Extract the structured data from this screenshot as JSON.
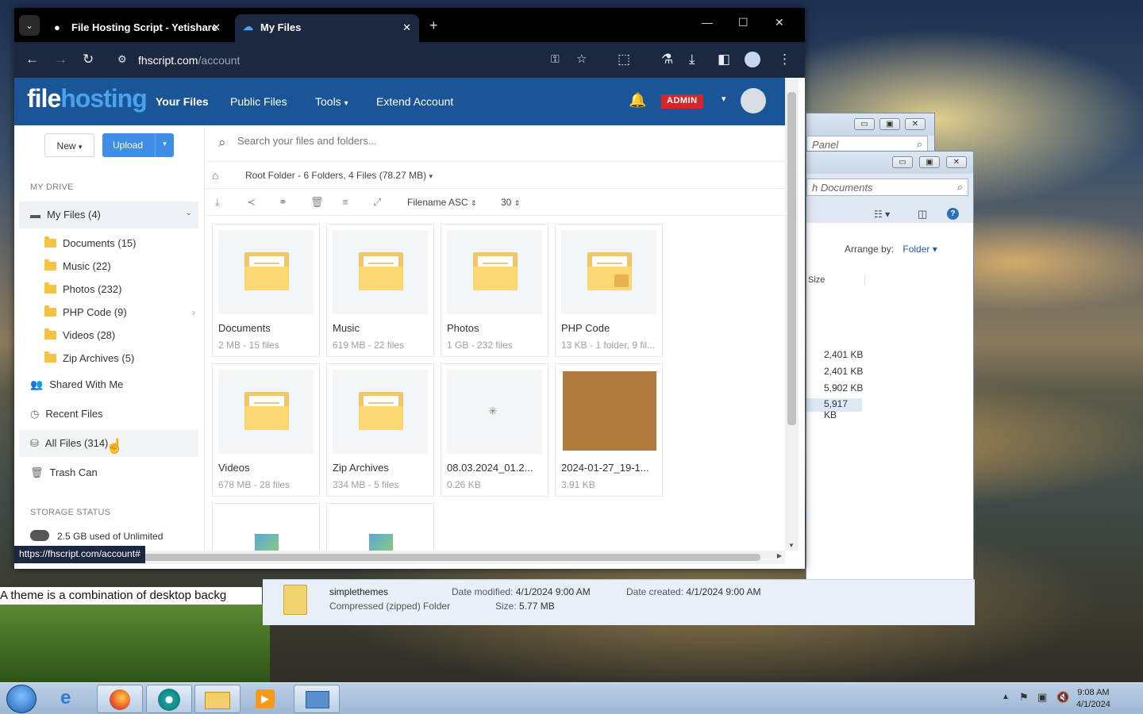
{
  "browser": {
    "tabs": [
      {
        "title": "File Hosting Script - Yetishare"
      },
      {
        "title": "My Files"
      }
    ],
    "url_domain": "fhscript.com",
    "url_path": "/account",
    "status_url": "https://fhscript.com/account#"
  },
  "app": {
    "logo_a": "file",
    "logo_b": "hosting",
    "nav": [
      "Your Files",
      "Public Files",
      "Tools",
      "Extend Account"
    ],
    "admin_badge": "ADMIN",
    "new_label": "New",
    "upload_label": "Upload",
    "search_placeholder": "Search your files and folders...",
    "breadcrumb": "Root Folder - 6 Folders, 4 Files (78.27 MB)",
    "sort": "Filename ASC",
    "per_page": "30"
  },
  "sidebar": {
    "my_drive": "MY DRIVE",
    "my_files": "My Files (4)",
    "folders": [
      "Documents (15)",
      "Music (22)",
      "Photos (232)",
      "PHP Code (9)",
      "Videos (28)",
      "Zip Archives (5)"
    ],
    "shared": "Shared With Me",
    "recent": "Recent Files",
    "all": "All Files (314)",
    "trash": "Trash Can",
    "storage_title": "STORAGE STATUS",
    "storage_used": "2.5 GB used of Unlimited"
  },
  "items": [
    {
      "name": "Documents",
      "meta": "2 MB - 15 files"
    },
    {
      "name": "Music",
      "meta": "619 MB - 22 files"
    },
    {
      "name": "Photos",
      "meta": "1 GB - 232 files"
    },
    {
      "name": "PHP Code",
      "meta": "13 KB - 1 folder, 9 fil..."
    },
    {
      "name": "Videos",
      "meta": "678 MB - 28 files"
    },
    {
      "name": "Zip Archives",
      "meta": "334 MB - 5 files"
    },
    {
      "name": "08.03.2024_01.2...",
      "meta": "0.26 KB"
    },
    {
      "name": "2024-01-27_19-1...",
      "meta": "3.91 KB"
    }
  ],
  "explorer": {
    "address1": "Panel",
    "address2": "h Documents",
    "arrange_label": "Arrange by:",
    "arrange_value": "Folder",
    "size_header": "Size",
    "sizes": [
      "2,401 KB",
      "2,401 KB",
      "5,902 KB",
      "5,917 KB"
    ],
    "detail": {
      "name": "simplethemes",
      "type": "Compressed (zipped) Folder",
      "modified_label": "Date modified:",
      "modified": "4/1/2024 9:00 AM",
      "created_label": "Date created:",
      "created": "4/1/2024 9:00 AM",
      "size_label": "Size:",
      "size": "5.77 MB"
    },
    "left_text": "A theme is a combination of desktop backg"
  },
  "taskbar": {
    "time": "9:08 AM",
    "date": "4/1/2024"
  }
}
